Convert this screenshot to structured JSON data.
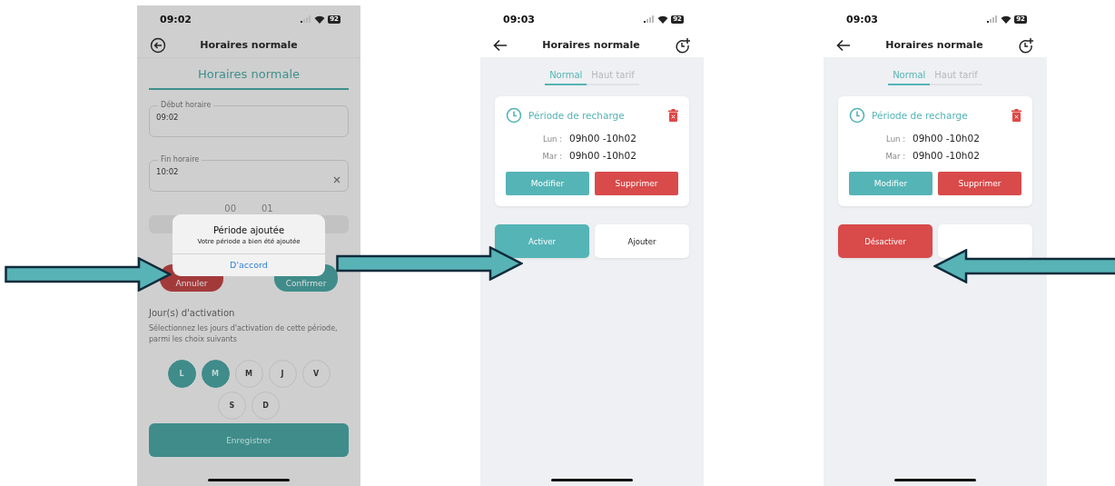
{
  "screens": [
    {
      "kind": "form",
      "time": "09:02",
      "battery": "92",
      "title": "Horaires normale",
      "section_tab": "Horaires normale",
      "fields": [
        {
          "label": "Début horaire",
          "value": "09:02",
          "clearable": false
        },
        {
          "label": "Fin horaire",
          "value": "10:02",
          "clearable": true
        }
      ],
      "picker_values": [
        "00",
        "01"
      ],
      "buttons": [
        {
          "label": "Annuler",
          "kind": "cancel"
        },
        {
          "label": "Confirmer",
          "kind": "confirm"
        }
      ],
      "days_title": "Jour(s) d'activation",
      "days_hint": "Sélectionnez les jours d'activation de cette période, parmi les choix suivants",
      "days": [
        {
          "label": "L",
          "selected": true
        },
        {
          "label": "M",
          "selected": true
        },
        {
          "label": "M",
          "selected": false
        },
        {
          "label": "J",
          "selected": false
        },
        {
          "label": "V",
          "selected": false
        },
        {
          "label": "S",
          "selected": false
        },
        {
          "label": "D",
          "selected": false
        }
      ],
      "save": "Enregistrer",
      "dialog": {
        "title": "Période ajoutée",
        "message": "Votre période a bien été ajoutée",
        "button": "D'accord"
      }
    },
    {
      "kind": "list",
      "time": "09:03",
      "battery": "92",
      "title": "Horaires normale",
      "tabs": [
        {
          "label": "Normal",
          "selected": true
        },
        {
          "label": "Haut tarif",
          "selected": false
        }
      ],
      "card": {
        "title": "Période de recharge",
        "rows": [
          {
            "day": "Lun :",
            "time": "09h00 -10h02"
          },
          {
            "day": "Mar :",
            "time": "09h00 -10h02"
          }
        ],
        "buttons": [
          {
            "label": "Modifier",
            "kind": "edit"
          },
          {
            "label": "Supprimer",
            "kind": "delete"
          }
        ]
      },
      "actions": [
        {
          "label": "Activer",
          "kind": "activate"
        },
        {
          "label": "Ajouter",
          "kind": "add"
        }
      ]
    },
    {
      "kind": "list",
      "time": "09:03",
      "battery": "92",
      "title": "Horaires normale",
      "tabs": [
        {
          "label": "Normal",
          "selected": true
        },
        {
          "label": "Haut tarif",
          "selected": false
        }
      ],
      "card": {
        "title": "Période de recharge",
        "rows": [
          {
            "day": "Lun :",
            "time": "09h00 -10h02"
          },
          {
            "day": "Mar :",
            "time": "09h00 -10h02"
          }
        ],
        "buttons": [
          {
            "label": "Modifier",
            "kind": "edit"
          },
          {
            "label": "Supprimer",
            "kind": "delete"
          }
        ]
      },
      "actions": [
        {
          "label": "Désactiver",
          "kind": "deactivate"
        },
        {
          "kind": "add"
        }
      ]
    }
  ]
}
